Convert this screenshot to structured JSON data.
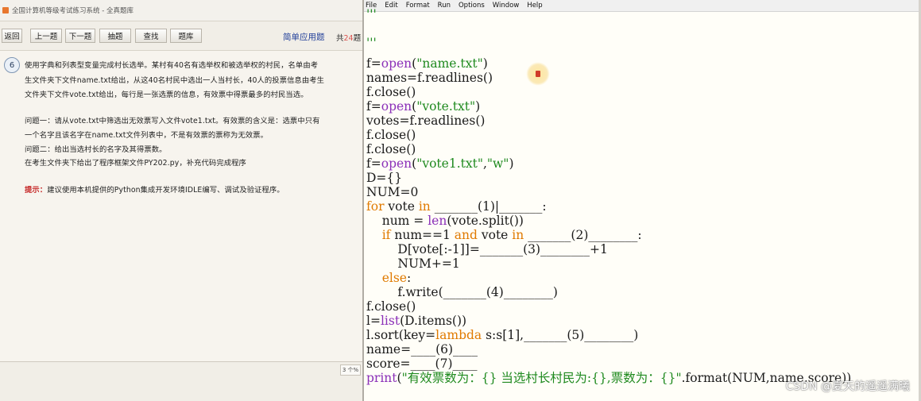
{
  "exam_window": {
    "title": "全国计算机等级考试练习系统 - 全真题库",
    "toolbar": {
      "buttons": [
        "返回",
        "上一题",
        "下一题",
        "抽题",
        "查找",
        "题库"
      ],
      "question_type": "简单应用题",
      "total_prefix": "共",
      "total_num": "24",
      "total_suffix": "题"
    },
    "question": {
      "number": "6",
      "lines": [
        "使用字典和列表型变量完成村长选举。某村有40名有选举权和被选举权的村民，名单由考",
        "生文件夹下文件name.txt给出，从这40名村民中选出一人当村长，40人的投票信息由考生",
        "文件夹下文件vote.txt给出，每行是一张选票的信息，有效票中得票最多的村民当选。",
        "问题一：请从vote.txt中筛选出无效票写入文件vote1.txt。有效票的含义是：选票中只有",
        "一个名字且该名字在name.txt文件列表中，不是有效票的票称为无效票。",
        "问题二：给出当选村长的名字及其得票数。",
        "在考生文件夹下给出了程序框架文件PY202.py，补充代码完成程序"
      ],
      "hint_label": "提示：",
      "hint_text": "建议使用本机提供的Python集成开发环境IDLE编写、调试及验证程序。"
    },
    "page_indicator": "3 个%"
  },
  "idle": {
    "menu": [
      "File",
      "Edit",
      "Format",
      "Run",
      "Options",
      "Window",
      "Help"
    ],
    "code_lines": [
      [
        {
          "t": "'''",
          "c": "str"
        }
      ],
      [
        {
          "t": "'''",
          "c": "str"
        }
      ],
      [
        {
          "t": "f=",
          "c": ""
        },
        {
          "t": "open",
          "c": "bi"
        },
        {
          "t": "(",
          "c": ""
        },
        {
          "t": "\"name.txt\"",
          "c": "str"
        },
        {
          "t": ")",
          "c": ""
        }
      ],
      [
        {
          "t": "names=f.readlines()",
          "c": ""
        }
      ],
      [
        {
          "t": "f.close()",
          "c": ""
        }
      ],
      [
        {
          "t": "f=",
          "c": ""
        },
        {
          "t": "open",
          "c": "bi"
        },
        {
          "t": "(",
          "c": ""
        },
        {
          "t": "\"vote.txt\"",
          "c": "str"
        },
        {
          "t": ")",
          "c": ""
        }
      ],
      [
        {
          "t": "votes=f.readlines()",
          "c": ""
        }
      ],
      [
        {
          "t": "f.close()",
          "c": ""
        }
      ],
      [
        {
          "t": "f.close()",
          "c": ""
        }
      ],
      [
        {
          "t": "f=",
          "c": ""
        },
        {
          "t": "open",
          "c": "bi"
        },
        {
          "t": "(",
          "c": ""
        },
        {
          "t": "\"vote1.txt\"",
          "c": "str"
        },
        {
          "t": ",",
          "c": ""
        },
        {
          "t": "\"w\"",
          "c": "str"
        },
        {
          "t": ")",
          "c": ""
        }
      ],
      [
        {
          "t": "D={}",
          "c": ""
        }
      ],
      [
        {
          "t": "NUM=0",
          "c": ""
        }
      ],
      [
        {
          "t": "for",
          "c": "kw"
        },
        {
          "t": " vote ",
          "c": ""
        },
        {
          "t": "in",
          "c": "kw"
        },
        {
          "t": " _______(1)|_______:",
          "c": ""
        }
      ],
      [
        {
          "t": "    num = ",
          "c": ""
        },
        {
          "t": "len",
          "c": "bi"
        },
        {
          "t": "(vote.split())",
          "c": ""
        }
      ],
      [
        {
          "t": "    ",
          "c": ""
        },
        {
          "t": "if",
          "c": "kw"
        },
        {
          "t": " num==1 ",
          "c": ""
        },
        {
          "t": "and",
          "c": "kw"
        },
        {
          "t": " vote ",
          "c": ""
        },
        {
          "t": "in",
          "c": "kw"
        },
        {
          "t": " _______(2)________:",
          "c": ""
        }
      ],
      [
        {
          "t": "        D[vote[:-1]]=_______(3)________+1",
          "c": ""
        }
      ],
      [
        {
          "t": "        NUM+=1",
          "c": ""
        }
      ],
      [
        {
          "t": "    ",
          "c": ""
        },
        {
          "t": "else",
          "c": "kw"
        },
        {
          "t": ":",
          "c": ""
        }
      ],
      [
        {
          "t": "        f.write(_______(4)________)",
          "c": ""
        }
      ],
      [
        {
          "t": "f.close()",
          "c": ""
        }
      ],
      [
        {
          "t": "l=",
          "c": ""
        },
        {
          "t": "list",
          "c": "bi"
        },
        {
          "t": "(D.items())",
          "c": ""
        }
      ],
      [
        {
          "t": "l.sort(key=",
          "c": ""
        },
        {
          "t": "lambda",
          "c": "kw"
        },
        {
          "t": " s:s[1],_______(5)________)",
          "c": ""
        }
      ],
      [
        {
          "t": "name=____(6)____",
          "c": ""
        }
      ],
      [
        {
          "t": "score=____(7)____",
          "c": ""
        }
      ],
      [
        {
          "t": "print",
          "c": "bi"
        },
        {
          "t": "(",
          "c": ""
        },
        {
          "t": "\"有效票数为：{} 当选村长村民为:{},票数为：{}\"",
          "c": "str"
        },
        {
          "t": ".format(NUM,name,score))",
          "c": ""
        }
      ]
    ],
    "watermark": "CSDN @夏天的遥遥满曦"
  }
}
